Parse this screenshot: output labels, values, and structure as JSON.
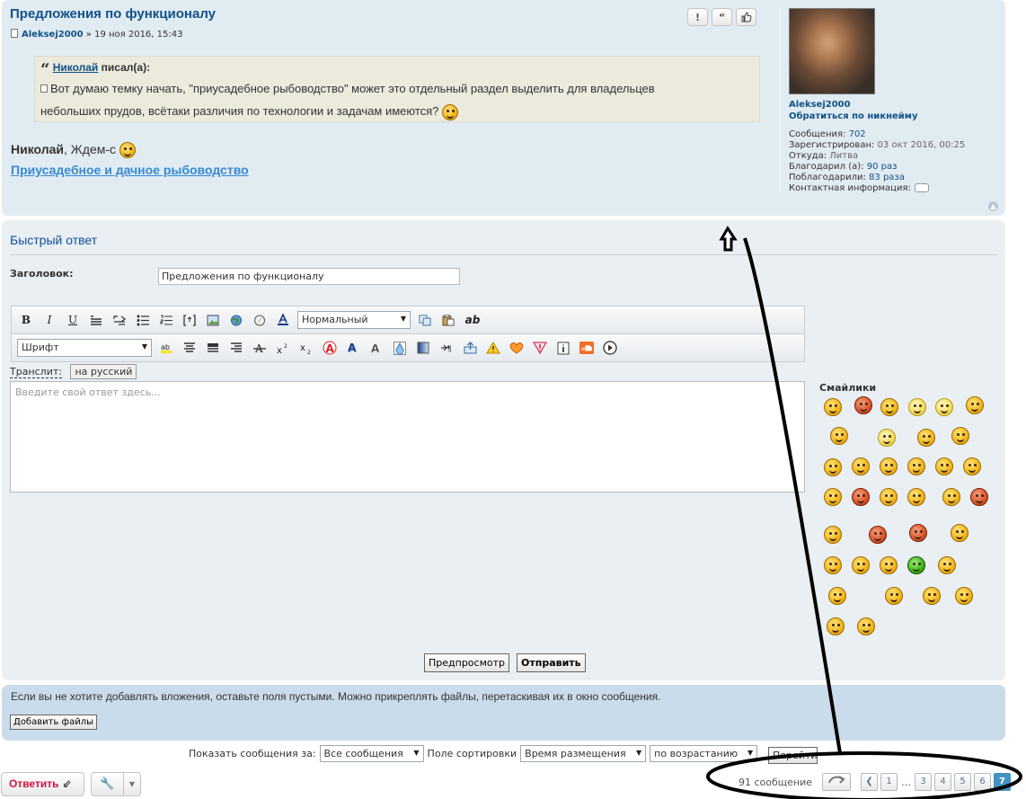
{
  "post": {
    "title": "Предложения по функционалу",
    "author": "Aleksej2000",
    "date_sep": "»",
    "date": "19 ноя 2016, 15:43",
    "buttons": [
      "!",
      "“",
      "👍"
    ],
    "quote": {
      "author": "Николай",
      "wrote": "писал(а):",
      "text_line1": "Вот думаю темку начать, \"приусадебное рыбоводство\" может это отдельный раздел выделить для владельцев",
      "text_line2": "небольших прудов, всётаки различия по технологии и задачам имеются?"
    },
    "body_name": "Николай",
    "body_text": ", Ждем-с",
    "body_link": "Приусадебное и дачное рыбоводство"
  },
  "profile": {
    "username": "Aleksej2000",
    "contact_by_nick": "Обратиться по никнейму",
    "posts_label": "Сообщения:",
    "posts_value": "702",
    "registered_label": "Зарегистрирован:",
    "registered_value": "03 окт 2016, 00:25",
    "from_label": "Откуда:",
    "from_value": "Литва",
    "thanked_label": "Благодарил (а):",
    "thanked_value": "90 раз",
    "thanks_label": "Поблагодарили:",
    "thanks_value": "83 раза",
    "contact_label": "Контактная информация:"
  },
  "quick_reply": {
    "title": "Быстрый ответ",
    "subject_label": "Заголовок:",
    "subject_value": "Предложения по функционалу",
    "toolbar": {
      "bold": "B",
      "italic": "I",
      "underline": "U",
      "style_select": "Нормальный",
      "font_select": "Шрифт",
      "ab": "ab"
    },
    "translit_label": "Транслит:",
    "translit_button": "на русский",
    "editor_placeholder": "Введите свой ответ здесь...",
    "smilies_title": "Смайлики",
    "preview_button": "Предпросмотр",
    "submit_button": "Отправить"
  },
  "attach": {
    "text": "Если вы не хотите добавлять вложения, оставьте поля пустыми. Можно прикреплять файлы, перетаскивая их в окно сообщения.",
    "button": "Добавить файлы"
  },
  "sort": {
    "show_label": "Показать сообщения за:",
    "show_value": "Все сообщения",
    "sort_label": "Поле сортировки",
    "sort_value": "Время размещения",
    "order_value": "по возрастанию",
    "go_button": "Перейти"
  },
  "actions": {
    "reply_button": "Ответить"
  },
  "pagination": {
    "count": "91 сообщение",
    "pages": [
      "1",
      "3",
      "4",
      "5",
      "6",
      "7"
    ],
    "ellipsis": "…",
    "current": "7"
  },
  "colors": {
    "post_bg": "#e1ebf2",
    "reply_bg": "#e9eff3",
    "attach_bg": "#cadceb",
    "link": "#105289",
    "accent_red": "#d31141",
    "page_active": "#4692bf"
  }
}
